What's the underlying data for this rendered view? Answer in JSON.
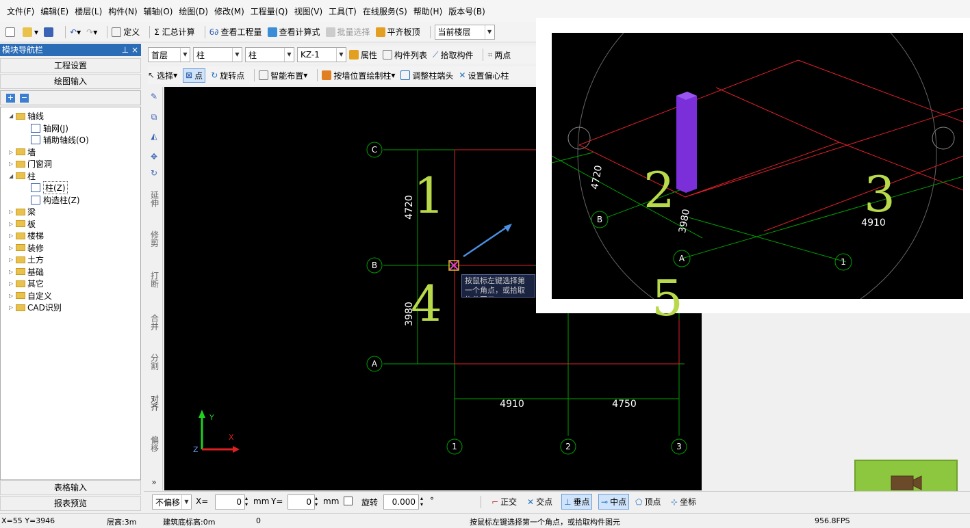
{
  "menu": [
    "文件(F)",
    "编辑(E)",
    "楼层(L)",
    "构件(N)",
    "辅轴(O)",
    "绘图(D)",
    "修改(M)",
    "工程量(Q)",
    "视图(V)",
    "工具(T)",
    "在线服务(S)",
    "帮助(H)",
    "版本号(B)"
  ],
  "toolbar1": {
    "define": "定义",
    "sum": "Σ 汇总计算",
    "view_qty": "查看工程量",
    "view_formula": "查看计算式",
    "batch_select": "批量选择",
    "flat_top": "平齐板顶",
    "floor_combo": "当前楼层"
  },
  "nav": {
    "title": "模块导航栏",
    "pin": "⊥ ×",
    "project_settings": "工程设置",
    "drawing_input": "绘图输入",
    "table_input": "表格输入",
    "report_preview": "报表预览"
  },
  "tree": [
    {
      "label": "轴线",
      "level": 0,
      "open": true
    },
    {
      "label": "轴网(J)",
      "level": 1
    },
    {
      "label": "辅助轴线(O)",
      "level": 1
    },
    {
      "label": "墙",
      "level": 0
    },
    {
      "label": "门窗洞",
      "level": 0
    },
    {
      "label": "柱",
      "level": 0,
      "open": true
    },
    {
      "label": "柱(Z)",
      "level": 1,
      "selected": true
    },
    {
      "label": "构造柱(Z)",
      "level": 1
    },
    {
      "label": "梁",
      "level": 0
    },
    {
      "label": "板",
      "level": 0
    },
    {
      "label": "楼梯",
      "level": 0
    },
    {
      "label": "装修",
      "level": 0
    },
    {
      "label": "土方",
      "level": 0
    },
    {
      "label": "基础",
      "level": 0
    },
    {
      "label": "其它",
      "level": 0
    },
    {
      "label": "自定义",
      "level": 0
    },
    {
      "label": "CAD识别",
      "level": 0
    }
  ],
  "toolbar2": {
    "floor": "首层",
    "type1": "柱",
    "type2": "柱",
    "component": "KZ-1",
    "attr": "属性",
    "list": "构件列表",
    "pick": "拾取构件",
    "twopoint": "两点"
  },
  "toolbar3": {
    "select": "选择",
    "point": "点",
    "rotate_point": "旋转点",
    "smart": "智能布置",
    "by_wall": "按墙位置绘制柱",
    "adjust_end": "调整柱端头",
    "set_offset": "设置偏心柱"
  },
  "vtools": [
    "延伸",
    "修剪",
    "打断",
    "合并",
    "分割",
    "对齐",
    "偏移"
  ],
  "axes": {
    "rows": [
      "C",
      "B",
      "A"
    ],
    "cols": [
      "1",
      "2",
      "3"
    ],
    "dims_left": [
      "4720",
      "3980"
    ],
    "dims_bottom": [
      "4910",
      "4750"
    ]
  },
  "tooltip": "按鼠标左键选择第一个角点，或拾取构件图元",
  "inset": {
    "dims": [
      "4720",
      "3980",
      "4910"
    ],
    "labels": [
      "B",
      "A",
      "1"
    ]
  },
  "overlays": [
    "1",
    "2",
    "3",
    "4",
    "5"
  ],
  "bottom": {
    "offset": "不偏移",
    "x_label": "X=",
    "x_val": "0",
    "unit": "mm",
    "y_label": "Y=",
    "y_val": "0",
    "rotate": "旋转",
    "rotate_val": "0.000",
    "deg": "°",
    "ortho": "正交",
    "intersect": "交点",
    "perp": "垂点",
    "mid": "中点",
    "vertex": "顶点",
    "coord": "坐标"
  },
  "status": {
    "coords": "X=55 Y=3946",
    "floor_height": "层高:3m",
    "base": "建筑底标高:0m",
    "zero": "0",
    "message": "按鼠标左键选择第一个角点，或拾取构件图元",
    "fps": "956.8FPS"
  },
  "colors": {
    "grid_line": "#00a000",
    "wall": "#e0202a",
    "column": "#7a2fd8",
    "overlay": "#b8d94a",
    "camera": "#8dc63f"
  }
}
